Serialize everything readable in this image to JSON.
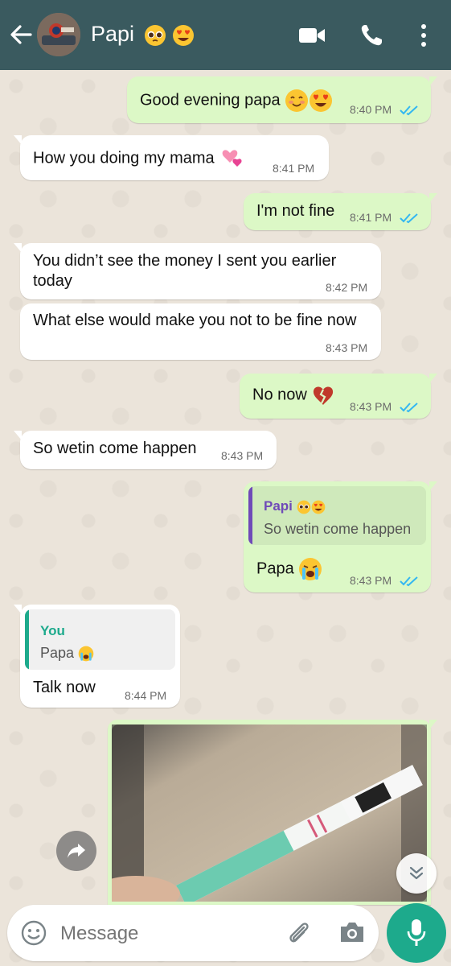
{
  "header": {
    "contact_name": "Papi",
    "icons": [
      "back-arrow-icon",
      "video-call-icon",
      "phone-icon",
      "more-options-icon"
    ],
    "color": "#3a5a5f"
  },
  "messages": [
    {
      "dir": "out",
      "text": "Good evening papa",
      "emoji": "blush,heart-eyes",
      "time": "8:40 PM",
      "status": "read"
    },
    {
      "dir": "in",
      "text": "How you doing my mama",
      "emoji": "revolving-hearts",
      "time": "8:41 PM"
    },
    {
      "dir": "out",
      "text": "I'm not fine",
      "time": "8:41 PM",
      "status": "read"
    },
    {
      "dir": "in",
      "text": "You didn’t see the money I sent you earlier today",
      "time": "8:42 PM"
    },
    {
      "dir": "in",
      "text": "What else would make you not to be fine now",
      "time": "8:43 PM"
    },
    {
      "dir": "out",
      "text": "No now",
      "emoji": "broken-heart",
      "time": "8:43 PM",
      "status": "read"
    },
    {
      "dir": "in",
      "text": "So wetin come happen",
      "time": "8:43 PM"
    },
    {
      "dir": "out",
      "quote_name": "Papi",
      "quote_text": "So wetin come happen",
      "text": "Papa",
      "emoji": "crying",
      "time": "8:43 PM",
      "status": "read"
    },
    {
      "dir": "in",
      "quote_name": "You",
      "quote_text": "Papa",
      "text": "Talk now",
      "time": "8:44 PM"
    },
    {
      "dir": "out",
      "type": "image",
      "image_desc": "photo"
    }
  ],
  "input": {
    "placeholder": "Message",
    "icons": [
      "emoji-icon",
      "attach-icon",
      "camera-icon",
      "mic-icon"
    ]
  },
  "colors": {
    "out_bubble": "#dcf8c6",
    "in_bubble": "#ffffff",
    "read_ticks": "#34b7f1",
    "quote_papi": "#6f4ab8",
    "quote_you": "#1daa8c",
    "accent": "#1daa8c"
  }
}
